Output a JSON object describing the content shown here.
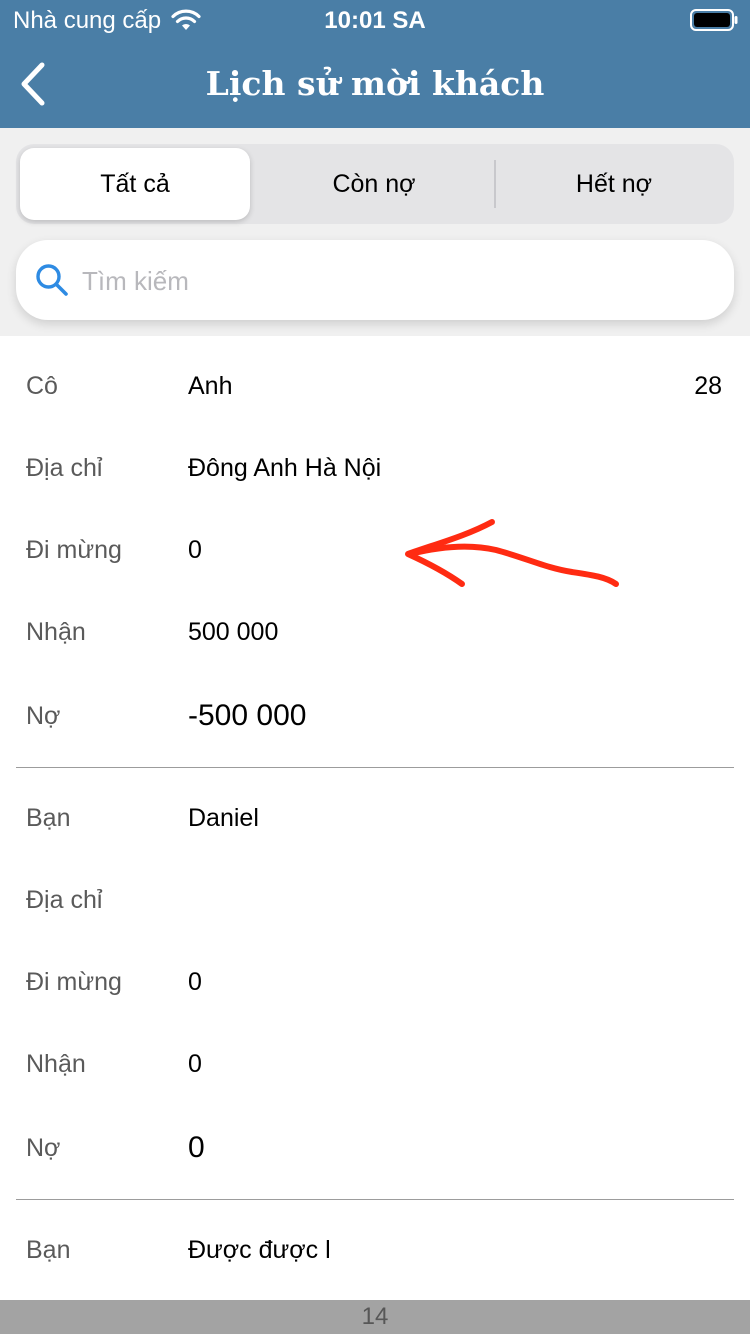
{
  "status_bar": {
    "carrier": "Nhà cung cấp",
    "time": "10:01 SA",
    "wifi_icon": "wifi-icon",
    "battery_icon": "battery-icon"
  },
  "nav": {
    "back_icon": "chevron-left-icon",
    "title": "Lịch sử mời khách"
  },
  "colors": {
    "header": "#4a7ea6",
    "annotation": "#ff2b12",
    "search_icon": "#2e8be3"
  },
  "tabs": [
    {
      "label": "Tất cả",
      "active": true
    },
    {
      "label": "Còn nợ",
      "active": false
    },
    {
      "label": "Hết nợ",
      "active": false
    }
  ],
  "search": {
    "placeholder": "Tìm kiếm",
    "value": ""
  },
  "records": [
    {
      "title_label": "Cô",
      "name": "Anh",
      "extra": "28",
      "address_label": "Địa chỉ",
      "address": "Đông Anh Hà Nội",
      "gift_label": "Đi mừng",
      "gift": "0",
      "received_label": "Nhận",
      "received": "500 000",
      "debt_label": "Nợ",
      "debt": "-500 000"
    },
    {
      "title_label": "Bạn",
      "name": "Daniel",
      "extra": "",
      "address_label": "Địa chỉ",
      "address": "",
      "gift_label": "Đi mừng",
      "gift": "0",
      "received_label": "Nhận",
      "received": "0",
      "debt_label": "Nợ",
      "debt": "0"
    },
    {
      "title_label": "Bạn",
      "name": "Được được l"
    }
  ],
  "footer": {
    "page": "14"
  }
}
